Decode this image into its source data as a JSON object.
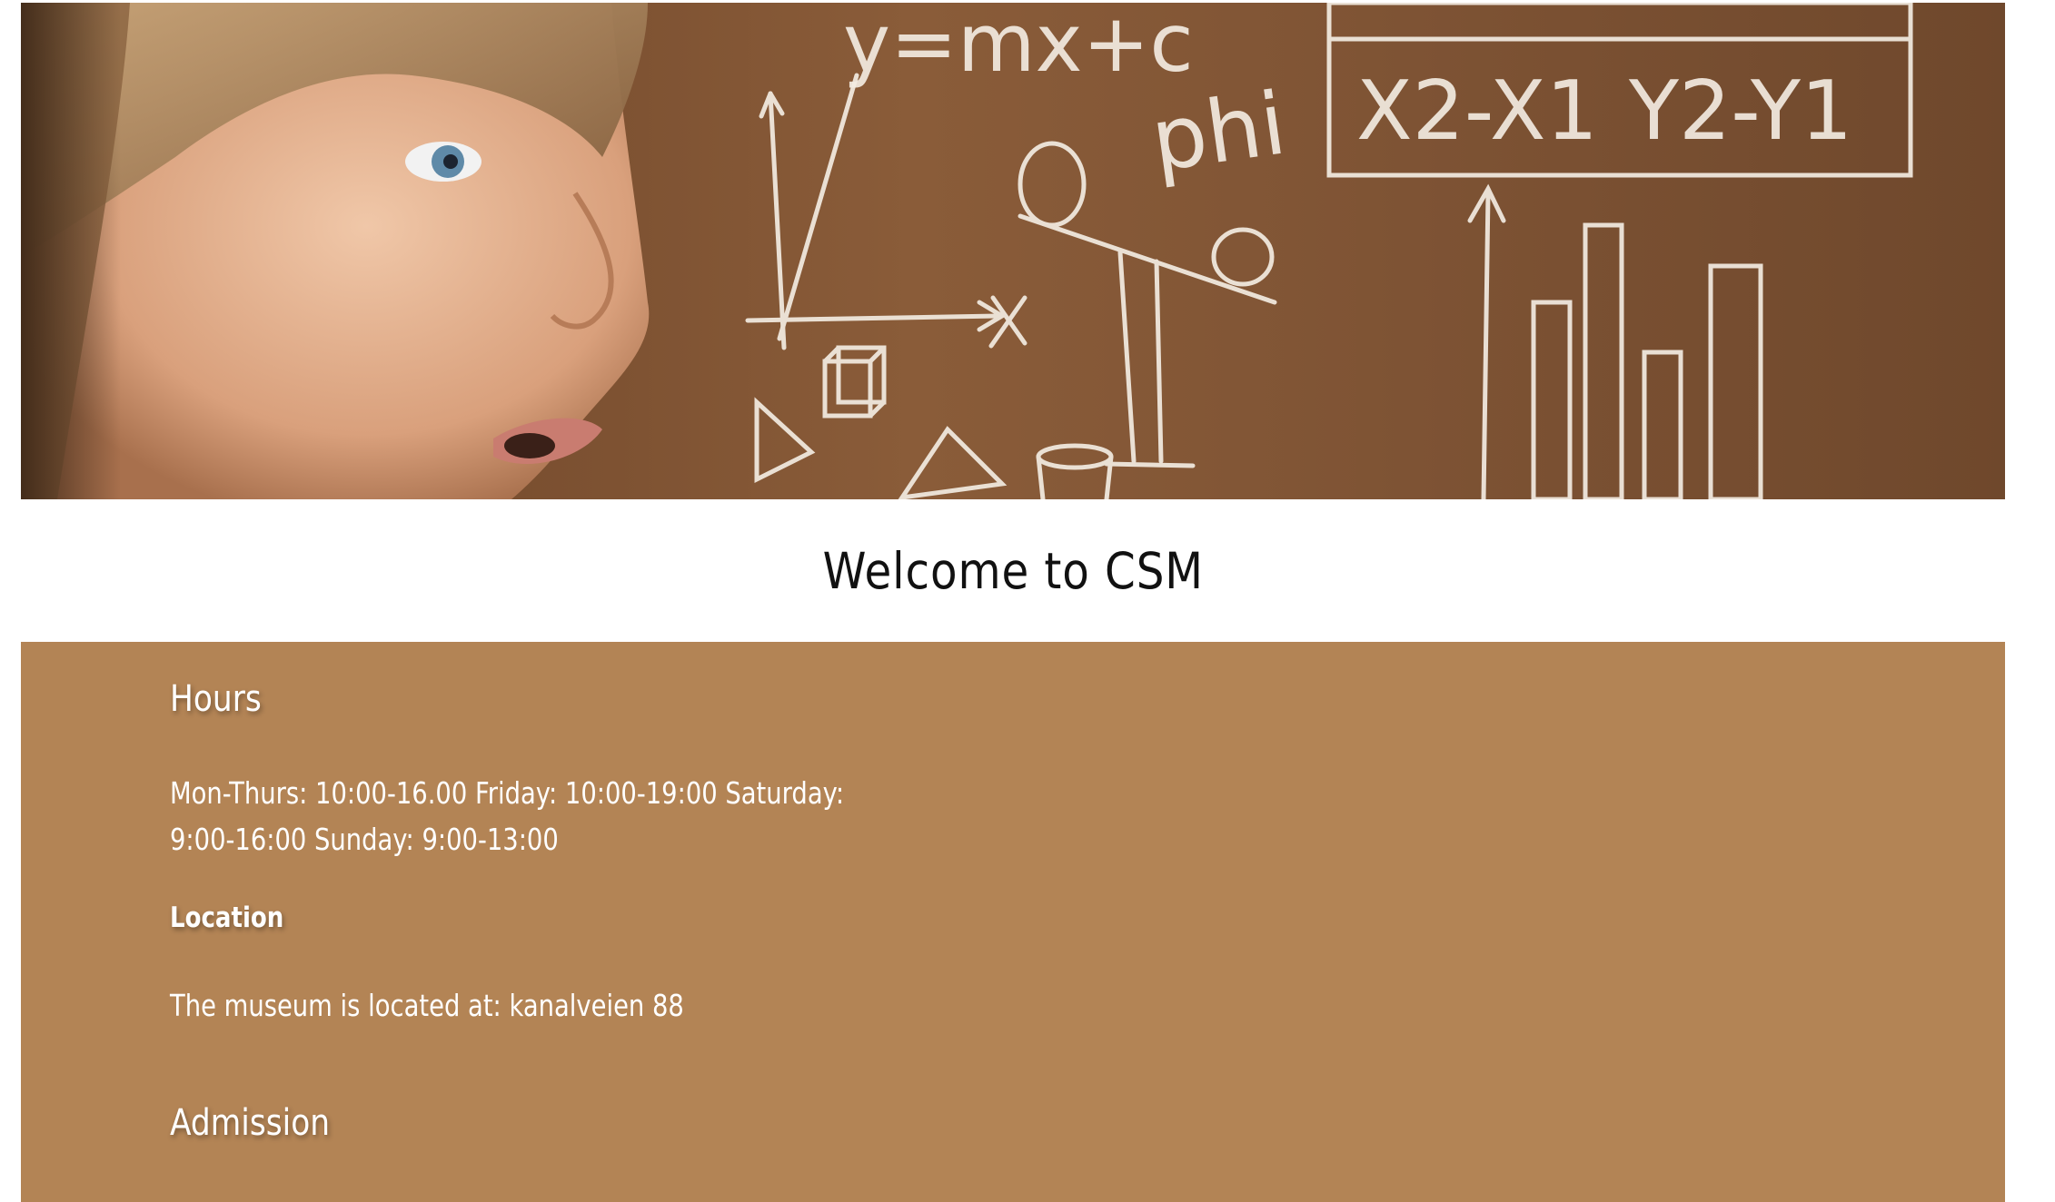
{
  "hero": {
    "image_alt": "girl-looking-at-chalkboard-with-math-drawings",
    "chalk_text": {
      "equation": "y=mx+c",
      "phi": "phi",
      "x_diff": "X2-X1",
      "y_diff": "Y2-Y1"
    }
  },
  "welcome": {
    "title": "Welcome to CSM"
  },
  "info": {
    "hours": {
      "title": "Hours",
      "text": "Mon-Thurs: 10:00-16.00 Friday: 10:00-19:00 Saturday: 9:00-16:00 Sunday: 9:00-13:00"
    },
    "location": {
      "title": "Location",
      "text": "The museum is located at: kanalveien 88"
    },
    "admission": {
      "title": "Admission"
    }
  },
  "colors": {
    "info_background": "#b38455",
    "hero_background": "#7a4f30",
    "chalk": "#f3ece2"
  }
}
